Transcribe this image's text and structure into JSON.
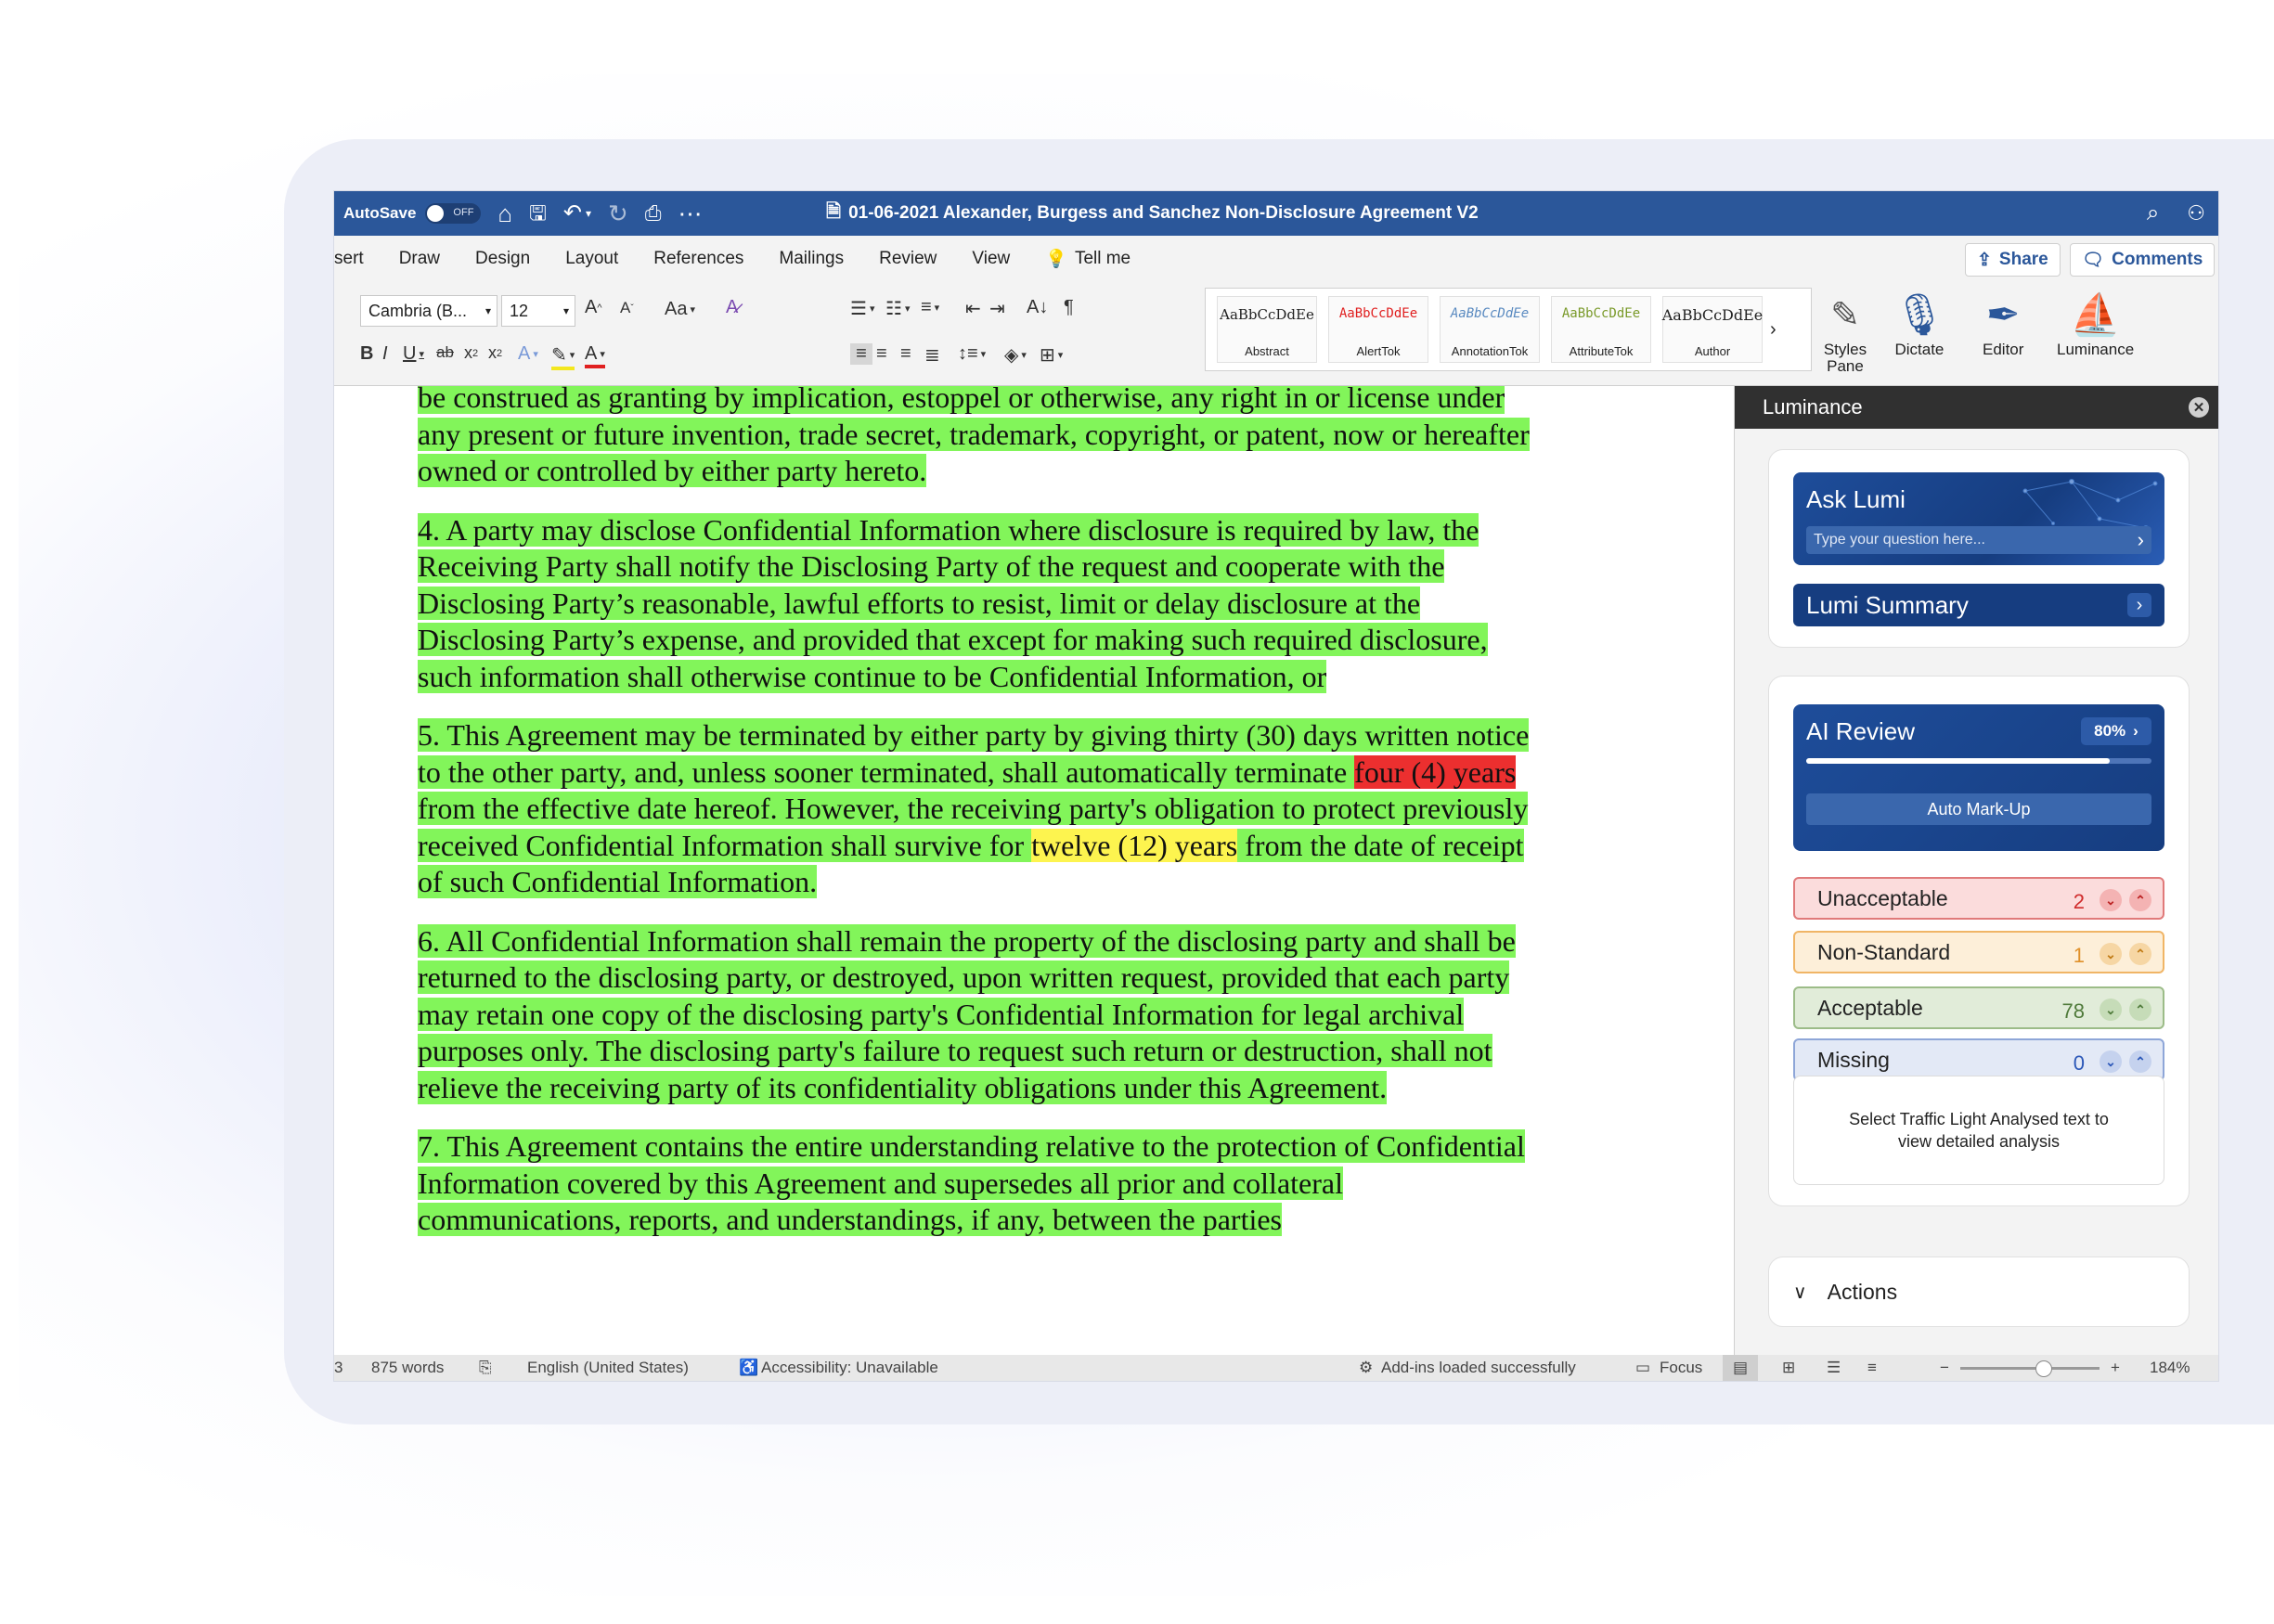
{
  "titlebar": {
    "autosave_label": "AutoSave",
    "autosave_state": "OFF",
    "doc_title": "01-06-2021 Alexander, Burgess and Sanchez Non-Disclosure Agreement V2"
  },
  "tabs": [
    "sert",
    "Draw",
    "Design",
    "Layout",
    "References",
    "Mailings",
    "Review",
    "View"
  ],
  "tell_me": "Tell me",
  "share_label": "Share",
  "comments_label": "Comments",
  "ribbon": {
    "font_name": "Cambria (B...",
    "font_size": "12",
    "styles": [
      {
        "sample": "AaBbCcDdEe",
        "name": "Abstract",
        "color": "#222222"
      },
      {
        "sample": "AaBbCcDdEe",
        "name": "AlertTok",
        "color": "#e02020"
      },
      {
        "sample": "AaBbCcDdEe",
        "name": "AnnotationTok",
        "color": "#5a8ac0"
      },
      {
        "sample": "AaBbCcDdEe",
        "name": "AttributeTok",
        "color": "#7a9a2a"
      },
      {
        "sample": "AaBbCcDdEe",
        "name": "Author",
        "color": "#222222"
      }
    ],
    "styles_pane": "Styles Pane",
    "dictate": "Dictate",
    "editor": "Editor",
    "luminance": "Luminance"
  },
  "document": {
    "p1": "be construed as granting by implication, estoppel or otherwise, any right in or license under any present or future invention, trade secret, trademark, copyright, or patent, now or hereafter owned or controlled by either party hereto.",
    "p2": "4. A party may disclose Confidential Information where disclosure is required by law, the Receiving Party shall notify the Disclosing Party of the request and cooperate with the Disclosing Party’s reasonable, lawful efforts to resist, limit or delay disclosure at the Disclosing Party’s expense, and provided that except for making such required disclosure, such information shall otherwise continue to be Confidential Information, or",
    "p3_a": "5. This Agreement may be terminated by either party by giving thirty (30) days written notice to the other party, and, unless sooner terminated, shall automatically terminate ",
    "p3_red": "four (4) years ",
    "p3_b": "from the effective date hereof. However, the receiving party's obligation to protect previously received Confidential Information shall survive for ",
    "p3_yellow": "twelve (12) years",
    "p3_c": " from the date of receipt of such Confidential Information.",
    "p4": "6. All Confidential Information shall remain the property of the disclosing party and shall be returned to the disclosing party, or destroyed, upon written request, provided that each party may retain one copy of the disclosing party's Confidential Information for legal archival purposes only. The disclosing party's failure to request such return or destruction, shall not relieve the receiving party of its confidentiality obligations under this Agreement.",
    "p5": "7. This Agreement contains the entire understanding relative to the protection of Confidential Information covered by this Agreement and supersedes all prior and collateral communications, reports, and understandings, if any, between the parties"
  },
  "pane": {
    "title": "Luminance",
    "ask_title": "Ask Lumi",
    "ask_placeholder": "Type your question here...",
    "summary_label": "Lumi Summary",
    "ai_title": "AI Review",
    "ai_percent_label": "80%",
    "ai_progress": 0.88,
    "auto_markup": "Auto Mark-Up",
    "categories": [
      {
        "label": "Unacceptable",
        "count": "2"
      },
      {
        "label": "Non-Standard",
        "count": "1"
      },
      {
        "label": "Acceptable",
        "count": "78"
      },
      {
        "label": "Missing",
        "count": "0"
      }
    ],
    "hint": "Select Traffic Light Analysed text to view detailed analysis",
    "actions_label": "Actions"
  },
  "status": {
    "page": "3",
    "words": "875 words",
    "language": "English (United States)",
    "accessibility": "Accessibility: Unavailable",
    "addins": "Add-ins loaded successfully",
    "focus": "Focus",
    "zoom": "184%",
    "zoom_level": 0.6
  },
  "colors": {
    "word_blue": "#2b579a",
    "highlight_green": "#82f55a",
    "highlight_red": "#ec2f2f",
    "highlight_yellow": "#fdf44f",
    "lumi_blue": "#163d80"
  }
}
